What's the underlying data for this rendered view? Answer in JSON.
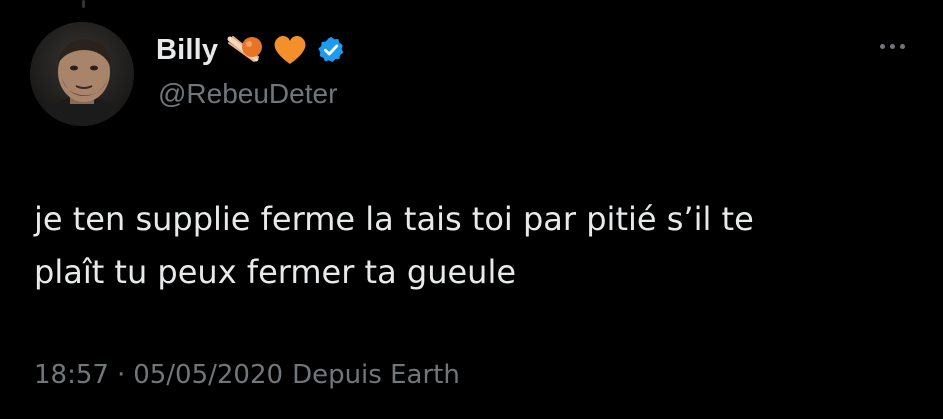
{
  "user": {
    "display_name": "Billy",
    "handle": "@RebeuDeter",
    "emojis": [
      "comet-emoji",
      "orange-heart-emoji"
    ],
    "verified_color": "#1d9bf0"
  },
  "tweet": {
    "text": "je ten supplie ferme la tais toi par pitié s’il te\nplaît tu peux fermer ta gueule",
    "time": "18:57",
    "separator": "·",
    "date": "05/05/2020",
    "source": "Depuis Earth"
  },
  "colors": {
    "background": "#000000",
    "text": "#e7e9ea",
    "secondary": "#71767b",
    "heart": "#f4902b"
  }
}
